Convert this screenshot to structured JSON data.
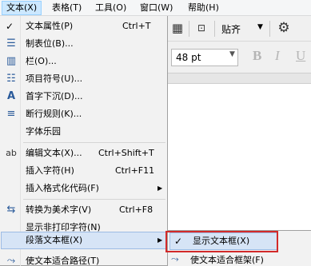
{
  "menubar": {
    "items": [
      {
        "label": "文本(X)"
      },
      {
        "label": "表格(T)"
      },
      {
        "label": "工具(O)"
      },
      {
        "label": "窗口(W)"
      },
      {
        "label": "帮助(H)"
      }
    ]
  },
  "toolbar": {
    "align_label": "贴齐",
    "font_size": "48 pt",
    "bold": "B",
    "italic": "I",
    "underline": "U"
  },
  "menu": {
    "items": [
      {
        "check": "✓",
        "label": "文本属性(P)",
        "shortcut": "Ctrl+T"
      },
      {
        "icon": "☰",
        "label": "制表位(B)..."
      },
      {
        "icon": "▥",
        "label": "栏(O)..."
      },
      {
        "icon": "☷",
        "label": "项目符号(U)..."
      },
      {
        "icon": "A",
        "label": "首字下沉(D)..."
      },
      {
        "icon": "≡",
        "label": "断行规则(K)..."
      },
      {
        "label": "字体乐园"
      },
      {
        "icon": "ab",
        "label": "编辑文本(X)...",
        "shortcut": "Ctrl+Shift+T"
      },
      {
        "label": "插入字符(H)",
        "shortcut": "Ctrl+F11"
      },
      {
        "label": "插入格式化代码(F)",
        "arrow": "▶"
      },
      {
        "icon": "⇆",
        "label": "转换为美术字(V)",
        "shortcut": "Ctrl+F8"
      },
      {
        "label": "显示非打印字符(N)"
      },
      {
        "label": "段落文本框(X)",
        "arrow": "▶"
      },
      {
        "icon": "⤳",
        "label": "使文本适合路径(T)"
      }
    ]
  },
  "submenu": {
    "items": [
      {
        "check": "✓",
        "label": "显示文本框(X)"
      },
      {
        "icon": "⤳",
        "label": "使文本适合框架(F)"
      }
    ]
  },
  "colors": {
    "highlight": "#d6e4f6",
    "annotation_box": "#d22a2a"
  }
}
